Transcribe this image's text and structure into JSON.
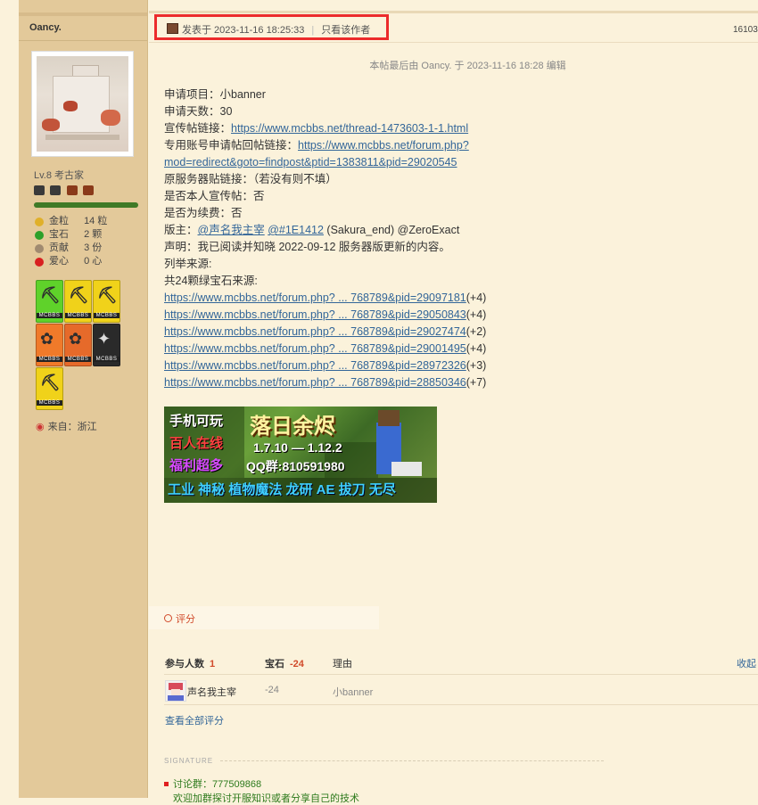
{
  "sidebar": {
    "username": "Oancy.",
    "level": "Lv.8 考古家",
    "badge_colors": [
      "#3a3a3a",
      "#3a3a3a",
      "#8a3a1a",
      "#8a3a1a"
    ],
    "level_progress": 1.0,
    "stats": [
      {
        "icon": "gold-coin-icon",
        "label": "金粒",
        "value": "14 粒",
        "color": "#e0b02a"
      },
      {
        "icon": "gem-icon",
        "label": "宝石",
        "value": "2 颗",
        "color": "#2da02a"
      },
      {
        "icon": "contribution-icon",
        "label": "贡献",
        "value": "3 份",
        "color": "#a08a70"
      },
      {
        "icon": "heart-icon",
        "label": "爱心",
        "value": "0 心",
        "color": "#d82020"
      }
    ],
    "medals": [
      {
        "name": "medal-green-pickaxe",
        "color": "#5fd22a",
        "tag": "MCBBS"
      },
      {
        "name": "medal-gold-pickaxe",
        "color": "#f0d21a",
        "tag": "MCBBS"
      },
      {
        "name": "medal-gold-pickaxe-2",
        "color": "#f0d21a",
        "tag": "MCBBS"
      },
      {
        "name": "medal-orange-1",
        "color": "#f07a2a",
        "tag": "MCBBS"
      },
      {
        "name": "medal-orange-2",
        "color": "#e66a2a",
        "tag": "MCBBS"
      },
      {
        "name": "medal-black",
        "color": "#2a2a2a",
        "tag": "MCBBS"
      },
      {
        "name": "medal-gold-pickaxe-3",
        "color": "#f0d21a",
        "tag": "MCBBS"
      }
    ],
    "hometown": "来自：浙江"
  },
  "post": {
    "posted_at": "发表于 2023-11-16 18:25:33",
    "only_author": "只看该作者",
    "post_number": "16103",
    "edited_note": "本帖最后由 Oancy. 于 2023-11-16 18:28 编辑",
    "lines": {
      "item": "申请项目：小banner",
      "days": "申请天数：30",
      "promo_label": "宣传帖链接：",
      "promo_link": "https://www.mcbbs.net/thread-1473603-1-1.html",
      "reply_label": "专用账号申请帖回帖链接：",
      "reply_link_1": "https://www.mcbbs.net/forum.php?",
      "reply_link_2": "mod=redirect&goto=findpost&ptid=1383811&pid=29020545",
      "original_server": "原服务器贴链接：（若没有则不填）",
      "self_promo": "是否本人宣传帖：否",
      "renewal": "是否为续费：否",
      "mod_label": "版主：",
      "mod_1": "@声名我主宰",
      "mod_2": "@#1E1412",
      "mod_rest": " (Sakura_end) @ZeroExact",
      "statement": "声明：我已阅读并知晓 2022-09-12 服务器版更新的内容。",
      "sources_label": "列举来源:",
      "sources_count": "共24颗绿宝石来源:"
    },
    "sources": [
      {
        "link": "https://www.mcbbs.net/forum.php? ... 768789&pid=29097181",
        "bonus": "(+4)"
      },
      {
        "link": "https://www.mcbbs.net/forum.php? ... 768789&pid=29050843",
        "bonus": "(+4)"
      },
      {
        "link": "https://www.mcbbs.net/forum.php? ... 768789&pid=29027474",
        "bonus": "(+2)"
      },
      {
        "link": "https://www.mcbbs.net/forum.php? ... 768789&pid=29001495",
        "bonus": "(+4)"
      },
      {
        "link": "https://www.mcbbs.net/forum.php? ... 768789&pid=28972326",
        "bonus": "(+3)"
      },
      {
        "link": "https://www.mcbbs.net/forum.php? ... 768789&pid=28850346",
        "bonus": "(+7)"
      }
    ],
    "banner": {
      "left_1": "手机可玩",
      "left_2": "百人在线",
      "left_3": "福利超多",
      "title": "落日余烬",
      "version": "1.7.10 — 1.12.2",
      "qq": "QQ群:810591980",
      "mods": "工业 神秘 植物魔法 龙研 AE 拔刀 无尽"
    }
  },
  "rating": {
    "label": "评分",
    "participants_label": "参与人数",
    "participants": "1",
    "gem_label": "宝石",
    "gem_total": "-24",
    "reason_label": "理由",
    "collapse": "收起",
    "rows": [
      {
        "user": "声名我主宰",
        "score": "-24",
        "reason": "小banner"
      }
    ],
    "view_all": "查看全部评分"
  },
  "signature": {
    "label": "SIGNATURE",
    "line_1": "讨论群：777509868",
    "line_2": "欢迎加群探讨开服知识或者分享自己的技术"
  }
}
